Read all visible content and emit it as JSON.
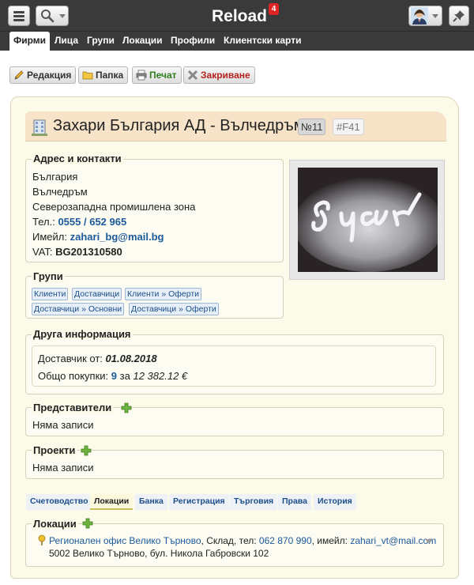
{
  "app": {
    "title": "Reload",
    "notification_count": "4"
  },
  "nav": {
    "tabs": [
      {
        "label": "Фирми",
        "active": true
      },
      {
        "label": "Лица"
      },
      {
        "label": "Групи"
      },
      {
        "label": "Локации"
      },
      {
        "label": "Профили"
      },
      {
        "label": "Клиентски карти"
      }
    ]
  },
  "toolbar": {
    "edit_label": "Редакция",
    "folder_label": "Папка",
    "print_label": "Печат",
    "close_label": "Закриване"
  },
  "company": {
    "name": "Захари България АД - Вълчедръм",
    "number": "№11",
    "code": "#F41"
  },
  "address": {
    "legend": "Адрес и контакти",
    "country": "България",
    "city": "Вълчедръм",
    "zone": "Северозападна промишлена зона",
    "phone_label": "Тел.:",
    "phone": "0555 / 652 965",
    "email_label": "Имейл:",
    "email": "zahari_bg@mail.bg",
    "vat_label": "VAT:",
    "vat": "BG201310580"
  },
  "groups": {
    "legend": "Групи",
    "tags": [
      "Клиенти",
      "Доставчици",
      "Клиенти » Оферти",
      "Доставчици » Основни",
      "Доставчици » Оферти"
    ]
  },
  "other": {
    "legend": "Друга информация",
    "supplier_since_label": "Доставчик от:",
    "supplier_since": "01.08.2018",
    "total_label": "Общо покупки:",
    "total_count": "9",
    "total_for": "за",
    "total_amount": "12 382.12 €"
  },
  "representatives": {
    "legend": "Представители",
    "empty": "Няма записи"
  },
  "projects": {
    "legend": "Проекти",
    "empty": "Няма записи"
  },
  "subtabs": [
    {
      "label": "Счетоводство"
    },
    {
      "label": "Локации",
      "active": true
    },
    {
      "label": "Банка"
    },
    {
      "label": "Регистрация"
    },
    {
      "label": "Търговия"
    },
    {
      "label": "Права"
    },
    {
      "label": "История"
    }
  ],
  "locations": {
    "legend": "Локации",
    "item_name": "Регионален офис Велико Търново",
    "item_middle": ", Склад, тел: ",
    "item_phone": "062 870 990",
    "item_email_label": ", имейл: ",
    "item_email": "zahari_vt@mail.com",
    "item_address": "5002 Велико Търново, бул. Никола Габровски 102"
  },
  "icons": {
    "menu": "hamburger-menu-icon",
    "search": "search-icon",
    "user": "user-avatar-icon",
    "pin": "pin-icon",
    "building": "building-icon",
    "edit": "pencil-icon",
    "folder": "folder-icon",
    "print": "printer-icon",
    "close": "cross-icon",
    "add": "plus-icon",
    "location": "map-pin-icon"
  },
  "colors": {
    "topbar": "#3a3a3a",
    "panel_bg": "#fcfae8",
    "title_bg": "#f6e3c8",
    "link": "#1c5a9c",
    "badge": "#e02424",
    "plus": "#6db33f"
  }
}
